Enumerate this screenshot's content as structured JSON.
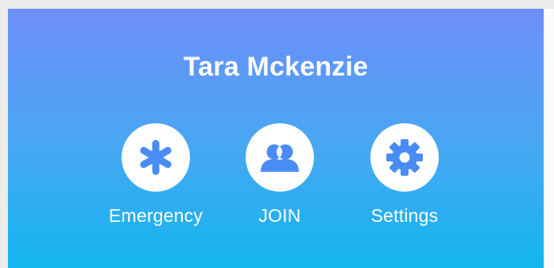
{
  "profile": {
    "name": "Tara Mckenzie"
  },
  "actions": [
    {
      "label": "Emergency",
      "icon": "asterisk-icon"
    },
    {
      "label": "JOIN",
      "icon": "people-icon"
    },
    {
      "label": "Settings",
      "icon": "gear-icon"
    }
  ],
  "colors": {
    "gradient_top": "#6d8ef9",
    "gradient_bottom": "#13b6ef",
    "icon_color": "#4a8cf5",
    "text": "#ffffff"
  }
}
